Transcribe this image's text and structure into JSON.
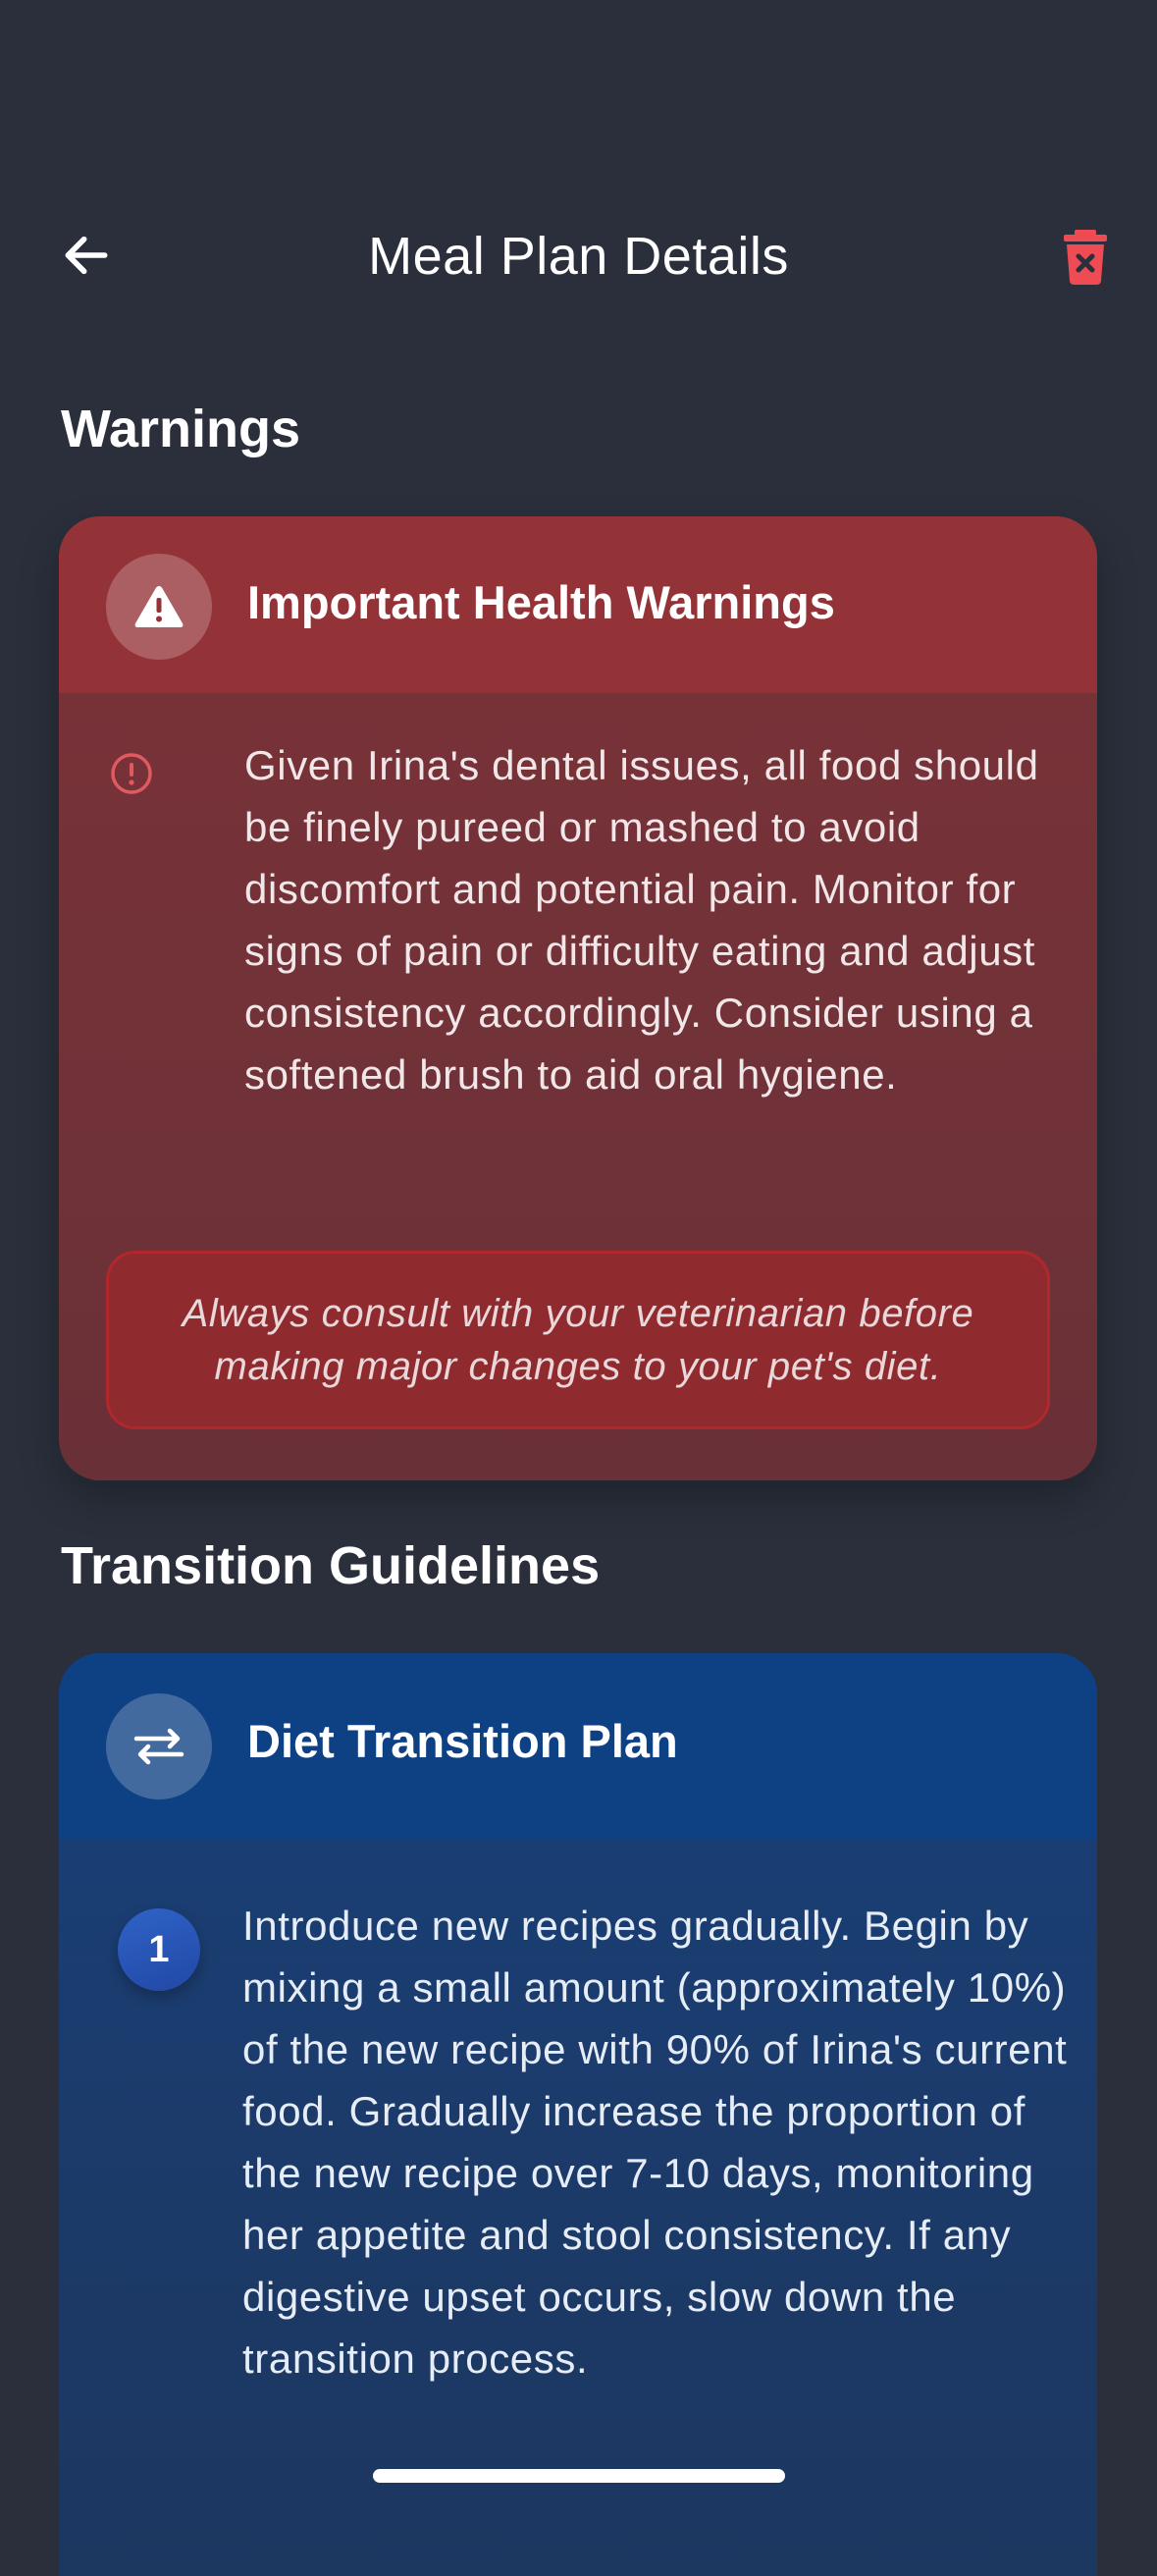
{
  "header": {
    "title": "Meal Plan Details",
    "back_icon": "arrow-left-icon",
    "delete_icon": "trash-icon"
  },
  "warnings_section": {
    "title": "Warnings",
    "card": {
      "heading": "Important Health Warnings",
      "heading_icon": "warning-triangle-icon",
      "items": [
        {
          "icon": "alert-circle-icon",
          "text": "Given Irina's dental issues, all food should be finely pureed or mashed to avoid discomfort and potential pain. Monitor for signs of pain or difficulty eating and adjust consistency accordingly.  Consider using a softened brush to aid oral hygiene."
        }
      ],
      "disclaimer": "Always consult with your veterinarian before making major changes to your pet's diet."
    }
  },
  "transition_section": {
    "title": "Transition Guidelines",
    "card": {
      "heading": "Diet Transition Plan",
      "heading_icon": "swap-arrows-icon",
      "steps": [
        {
          "number": "1",
          "text": "Introduce new recipes gradually. Begin by mixing a small amount (approximately 10%) of the new recipe with 90% of Irina's current food. Gradually increase the proportion of the new recipe over 7-10 days, monitoring her appetite and stool consistency. If any digestive upset occurs, slow down the transition process."
        }
      ]
    }
  },
  "colors": {
    "background": "#2a2f3b",
    "warning_card": "#7a3237",
    "warning_header": "#943337",
    "warning_accent": "#e05a5f",
    "delete_icon": "#ef4b55",
    "transition_card": "#19407a",
    "transition_header": "#0e4184",
    "step_badge": "#2f63c7"
  }
}
